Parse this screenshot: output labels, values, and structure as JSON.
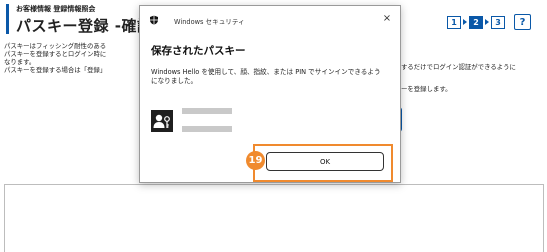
{
  "header": {
    "breadcrumb": "お客様情報 登録情報照会",
    "title": "パスキー登録 -確認-"
  },
  "steps": {
    "items": [
      "1",
      "2",
      "3"
    ],
    "active": "2",
    "help_icon": "help-icon"
  },
  "body": {
    "line1_left": "パスキーはフィッシング耐性のある",
    "line2_left": "パスキーを登録するとログイン時に",
    "line3_left": "なります。",
    "line4_left": "パスキーを登録する場合は「登録」",
    "line2_right": "するだけでログイン認証ができるように",
    "line4_right": "ーを登録します。"
  },
  "dialog": {
    "app_name": "Windows セキュリティ",
    "close_glyph": "×",
    "heading": "保存されたパスキー",
    "description_line1": "Windows Hello を使用して、顔、指紋、または PIN でサインインできるよう",
    "description_line2": "になりました。",
    "ok_label": "OK",
    "annotation_number": "19",
    "colors": {
      "annotation": "#f08a2e",
      "brand": "#0a58a8"
    }
  }
}
